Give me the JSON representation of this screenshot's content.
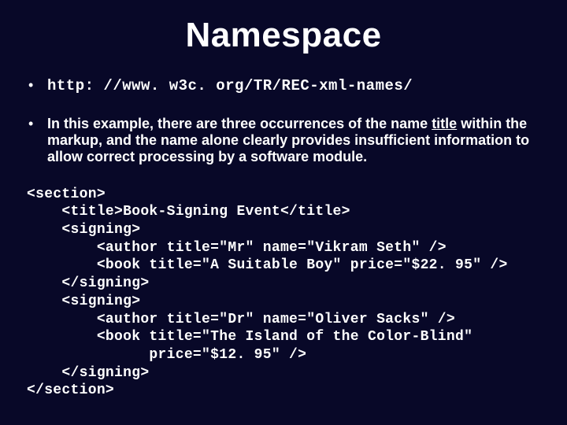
{
  "slide": {
    "title": "Namespace",
    "bullets": {
      "url": "http: //www. w3c. org/TR/REC-xml-names/",
      "desc_pre": "In this example, there are three occurrences of the name ",
      "desc_underlined": "title",
      "desc_post": " within the markup, and the name alone clearly provides insufficient information to allow correct processing by a software module."
    },
    "code": "<section>\n    <title>Book-Signing Event</title>\n    <signing>\n        <author title=\"Mr\" name=\"Vikram Seth\" />\n        <book title=\"A Suitable Boy\" price=\"$22. 95\" />\n    </signing>\n    <signing>\n        <author title=\"Dr\" name=\"Oliver Sacks\" />\n        <book title=\"The Island of the Color-Blind\"\n              price=\"$12. 95\" />\n    </signing>\n</section>"
  }
}
